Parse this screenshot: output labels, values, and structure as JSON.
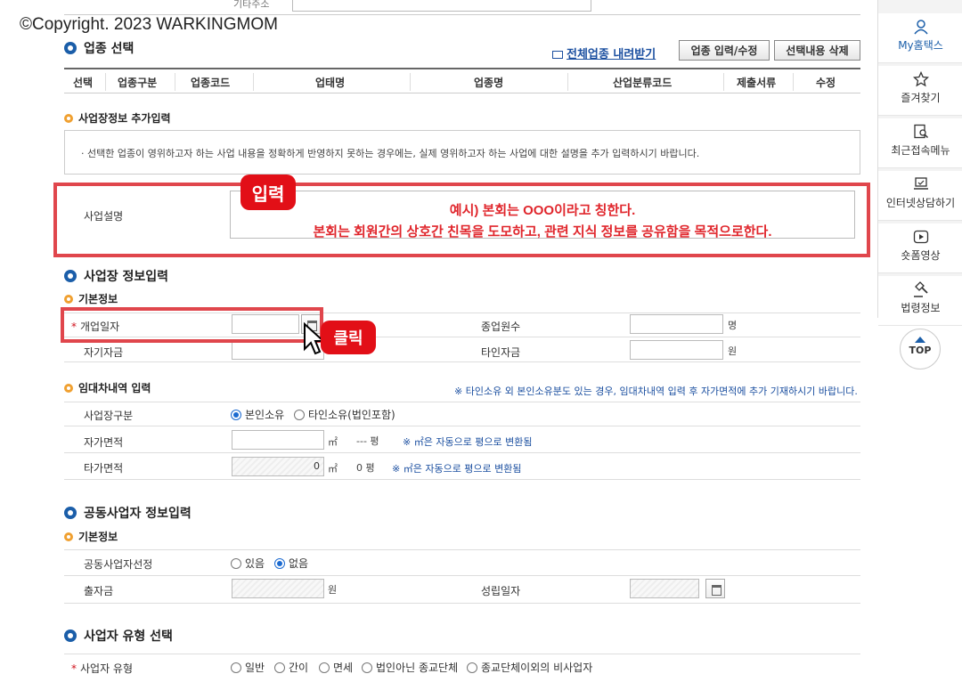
{
  "watermark": "©Copyright. 2023 WARKINGMOM",
  "top": {
    "address_label": "기타주소"
  },
  "industry": {
    "title": "업종 선택",
    "download_link": "전체업종 내려받기",
    "btn_edit": "업종 입력/수정",
    "btn_delete": "선택내용 삭제",
    "columns": [
      "선택",
      "업종구분",
      "업종코드",
      "업태명",
      "업종명",
      "산업분류코드",
      "제출서류",
      "수정"
    ]
  },
  "extra": {
    "title": "사업장정보 추가입력",
    "notice": "선택한 업종이 영위하고자 하는 사업 내용을 정확하게 반영하지 못하는 경우에는, 실제 영위하고자 하는 사업에 대한 설명을 추가 입력하시기 바랍니다.",
    "desc_label": "사업설명",
    "desc_line1": "예시) 본회는 OOO이라고 칭한다.",
    "desc_line2": "본회는 회원간의 상호간 친목을 도모하고, 관련 지식 정보를 공유함을 목적으로한다.",
    "badge_input": "입력"
  },
  "biz": {
    "title": "사업장 정보입력",
    "basic_title": "기본정보",
    "open_date_label": "개업일자",
    "employees_label": "종업원수",
    "employees_unit": "명",
    "own_capital_label": "자기자금",
    "other_capital_label": "타인자금",
    "capital_unit": "원",
    "badge_click": "클릭"
  },
  "lease": {
    "title": "임대차내역 입력",
    "notice": "※ 타인소유 외 본인소유분도 있는 경우, 임대차내역 입력 후 자가면적에 추가 기재하시기 바랍니다.",
    "type_label": "사업장구분",
    "opt_own": "본인소유",
    "opt_other": "타인소유(법인포함)",
    "own_area_label": "자가면적",
    "own_area_unit": "㎡",
    "own_area_pyeong": "--- 평",
    "area_help": "※ ㎡은 자동으로 평으로 변환됨",
    "other_area_label": "타가면적",
    "other_area_value": "0",
    "other_area_unit": "㎡",
    "other_area_pyeong": "0 평",
    "other_area_help": "※ ㎡은 자동으로 평으로 변환됨"
  },
  "joint": {
    "title": "공동사업자 정보입력",
    "basic_title": "기본정보",
    "select_label": "공동사업자선정",
    "opt_yes": "있음",
    "opt_no": "없음",
    "invest_label": "출자금",
    "invest_unit": "원",
    "found_date_label": "성립일자"
  },
  "biztype": {
    "title": "사업자 유형 선택",
    "label": "사업자 유형",
    "options": [
      "일반",
      "간이",
      "면세",
      "법인아닌 종교단체",
      "종교단체이외의 비사업자"
    ]
  },
  "sidebar": {
    "items": [
      "My홈택스",
      "즐겨찾기",
      "최근접속메뉴",
      "인터넷상담하기",
      "숏폼영상",
      "법령정보"
    ],
    "top": "TOP"
  }
}
